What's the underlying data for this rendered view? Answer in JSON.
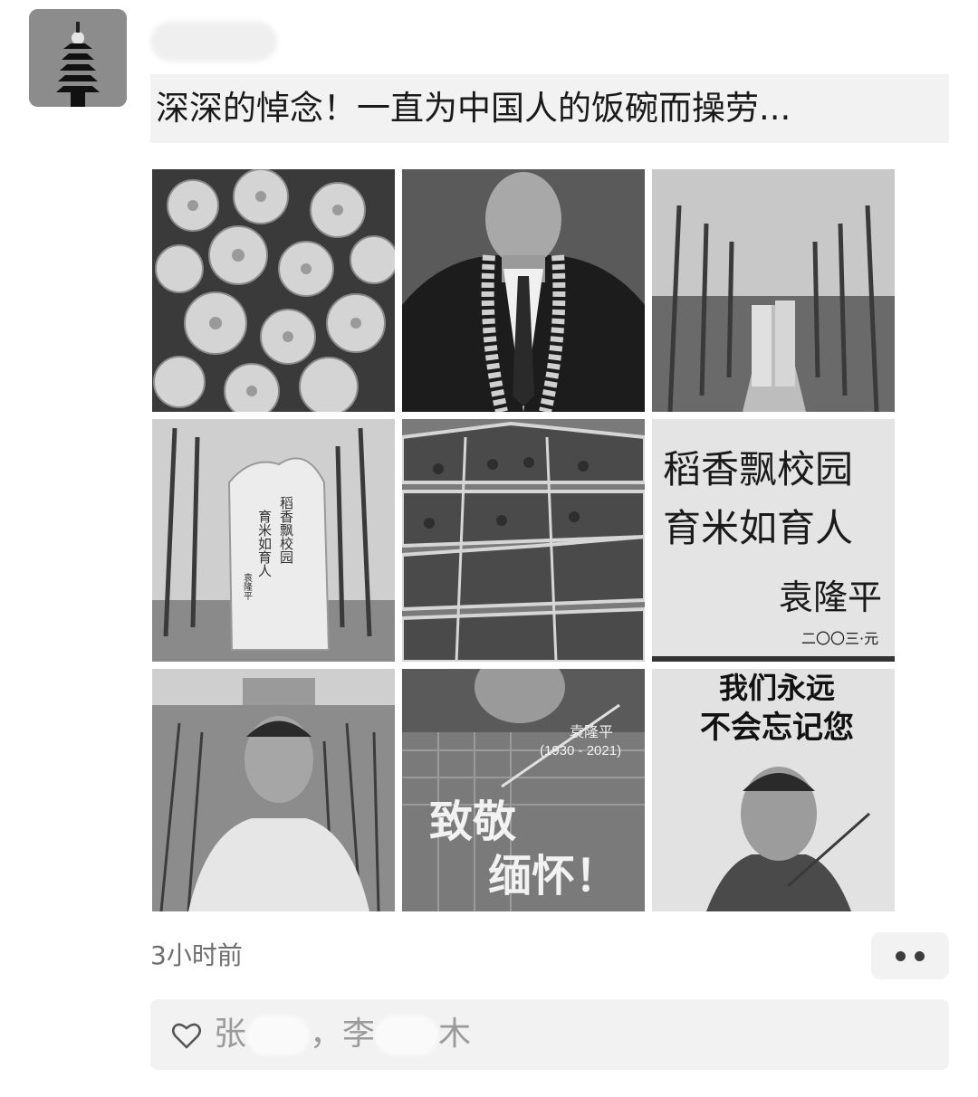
{
  "post": {
    "nickname": "",
    "text": "深深的悼念！一直为中国人的饭碗而操劳...",
    "time": "3小时前"
  },
  "images": [
    {
      "name": "chrysanthemums"
    },
    {
      "name": "portrait-with-medal"
    },
    {
      "name": "tree-lined-path-stone"
    },
    {
      "name": "stone-monument",
      "lines": [
        "稻香飘校园",
        "育米如育人"
      ],
      "signature": "袁隆平"
    },
    {
      "name": "rice-field-plots"
    },
    {
      "name": "calligraphy",
      "line1": "稻香飘校园",
      "line2": "育米如育人",
      "signature": "袁隆平",
      "date": "二〇〇三·元"
    },
    {
      "name": "man-in-rice-field"
    },
    {
      "name": "tribute",
      "name_text": "袁隆平",
      "years": "(1930 - 2021)",
      "line1": "致敬",
      "line2": "缅怀！"
    },
    {
      "name": "never-forget",
      "line1": "我们永远",
      "line2": "不会忘记您"
    }
  ],
  "likes": {
    "icon": "heart-icon",
    "names": [
      "张",
      "，",
      "李",
      "木"
    ]
  },
  "more_icon": "more-dots-icon",
  "colors": {
    "text": "#1a1a1a",
    "meta": "#6e6e6e",
    "panel": "#f2f2f2"
  }
}
